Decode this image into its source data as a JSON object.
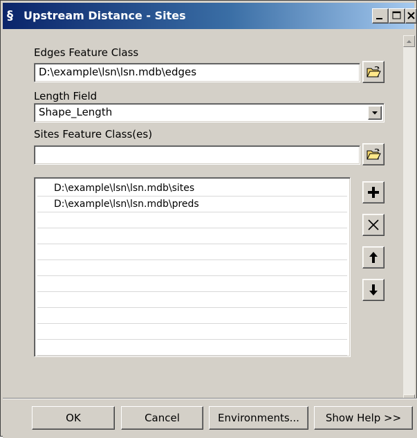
{
  "window": {
    "title": "Upstream Distance - Sites",
    "controls": {
      "minimize": "_",
      "maximize": "□",
      "close": "×"
    }
  },
  "form": {
    "edges": {
      "label": "Edges Feature Class",
      "value": "D:\\example\\lsn\\lsn.mdb\\edges"
    },
    "length_field": {
      "label": "Length Field",
      "value": "Shape_Length"
    },
    "sites": {
      "label": "Sites Feature Class(es)",
      "value": "",
      "items": [
        "D:\\example\\lsn\\lsn.mdb\\sites",
        "D:\\example\\lsn\\lsn.mdb\\preds",
        "",
        "",
        "",
        "",
        "",
        "",
        "",
        "",
        "",
        ""
      ]
    }
  },
  "icons": {
    "browse": "open-folder-icon",
    "add": "plus-icon",
    "remove": "x-icon",
    "up": "arrow-up-icon",
    "down": "arrow-down-icon"
  },
  "footer": {
    "ok": "OK",
    "cancel": "Cancel",
    "environments": "Environments...",
    "show_help": "Show Help >>"
  }
}
